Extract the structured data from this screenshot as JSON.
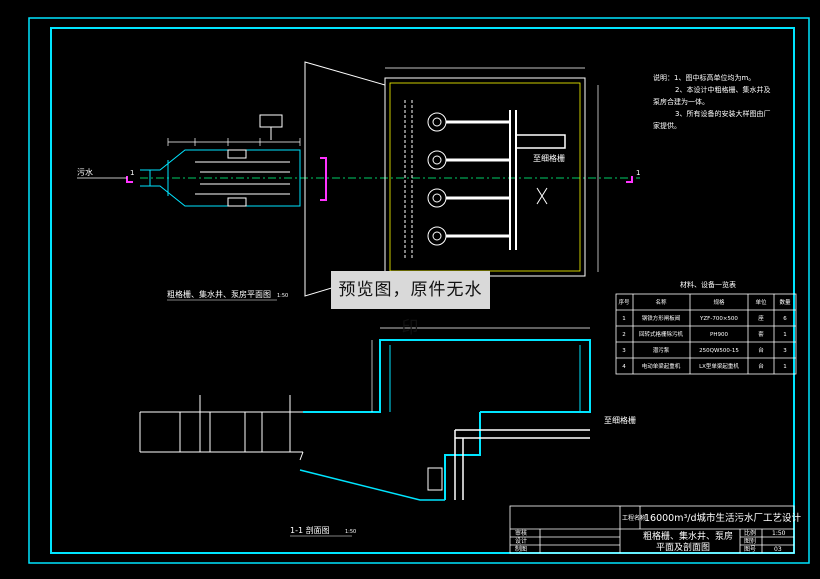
{
  "colors": {
    "frame": "#00e5ff",
    "line": "#ffffff",
    "accent": "#ff33ff",
    "note": "#ffff00",
    "bg": "#000000"
  },
  "watermark": "预览图，原件无水印",
  "labels": {
    "plan_title": "粗格栅、集水井、泵房平面图",
    "plan_scale": "1:50",
    "section_title": "1-1 剖面图",
    "section_scale": "1:50",
    "inflow": "污水",
    "to_fine_screen_top": "至细格栅",
    "to_fine_screen_bottom": "至细格栅",
    "section_mark_left": "1",
    "section_mark_right": "1"
  },
  "notes": [
    "说明：1、图中标高单位均为m。",
    "2、本设计中粗格栅、集水井及",
    "泵房合建为一体。",
    "3、所有设备的安装大样图由厂",
    "家提供。"
  ],
  "table": {
    "title": "材料、设备一览表",
    "headers": [
      "序号",
      "名称",
      "规格",
      "单位",
      "数量"
    ],
    "rows": [
      [
        "1",
        "钢铁方形闸板阀",
        "YZF-700×500",
        "座",
        "6"
      ],
      [
        "2",
        "回转式格栅除污机",
        "PH900",
        "套",
        "1"
      ],
      [
        "3",
        "潜污泵",
        "250QW500-15",
        "台",
        "3"
      ],
      [
        "4",
        "电动单梁起重机",
        "LX型单梁起重机",
        "台",
        "1"
      ]
    ]
  },
  "title_block": {
    "project_label": "工程名称",
    "project_name": "16000m³/d城市生活污水厂工艺设计",
    "drawing_name_1": "粗格栅、集水井、泵房",
    "drawing_name_2": "平面及剖面图",
    "row_labels": [
      "审核",
      "设计",
      "制图"
    ],
    "scale_label": "比例",
    "scale_value": "1:50",
    "sheet_label": "图别",
    "sheet_value": "",
    "number_label": "图号",
    "number_value": "03"
  }
}
